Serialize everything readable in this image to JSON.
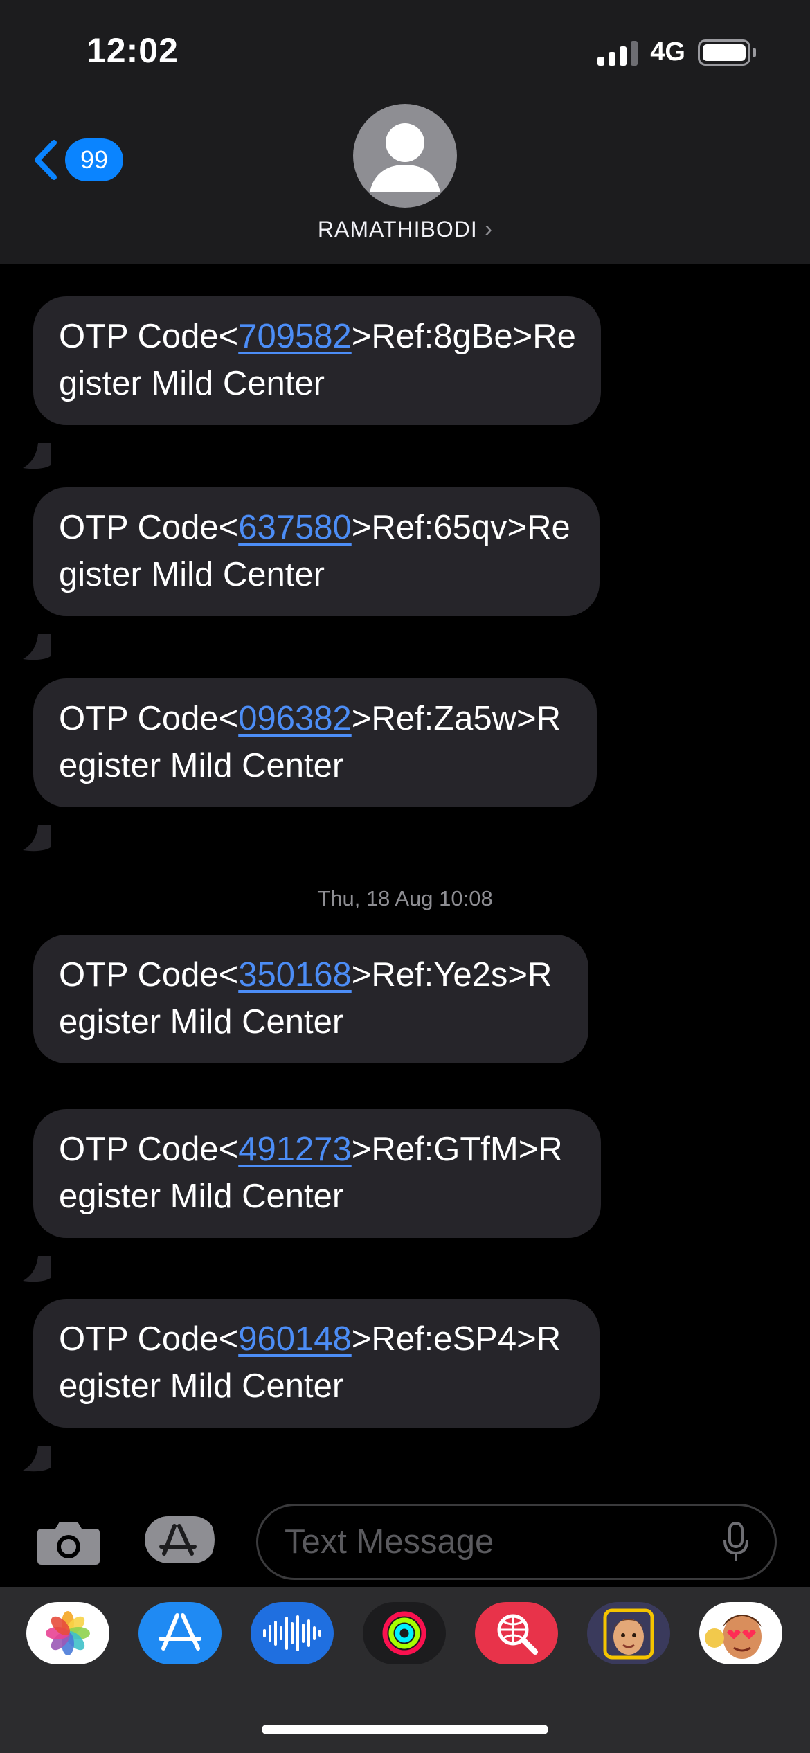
{
  "status_bar": {
    "time": "12:02",
    "network": "4G"
  },
  "nav": {
    "back_badge": "99",
    "contact_name": "RAMATHIBODI",
    "name_chevron": "›"
  },
  "messages": [
    {
      "prefix": "OTP Code<",
      "code": "709582",
      "suffix": ">Ref:8gBe>Register Mild Center"
    },
    {
      "prefix": "OTP Code<",
      "code": "637580",
      "suffix": ">Ref:65qv>Register Mild Center"
    },
    {
      "prefix": "OTP Code<",
      "code": "096382",
      "suffix": ">Ref:Za5w>Register Mild Center"
    },
    {
      "prefix": "OTP Code<",
      "code": "350168",
      "suffix": ">Ref:Ye2s>Register Mild Center"
    },
    {
      "prefix": "OTP Code<",
      "code": "491273",
      "suffix": ">Ref:GTfM>Register Mild Center"
    },
    {
      "prefix": "OTP Code<",
      "code": "960148",
      "suffix": ">Ref:eSP4>Register Mild Center"
    }
  ],
  "timestamp": {
    "day": "Thu, 18 Aug",
    "time": "10:08"
  },
  "input": {
    "placeholder": "Text Message"
  },
  "app_drawer": {
    "apps": [
      "photos-icon",
      "app-store-icon",
      "audio-message-icon",
      "fitness-rings-icon",
      "image-search-icon",
      "memoji-icon",
      "animoji-stickers-icon"
    ]
  },
  "colors": {
    "bubble": "#26252a",
    "link": "#4c8df6",
    "accent": "#0a84ff",
    "header": "#1c1c1e"
  }
}
